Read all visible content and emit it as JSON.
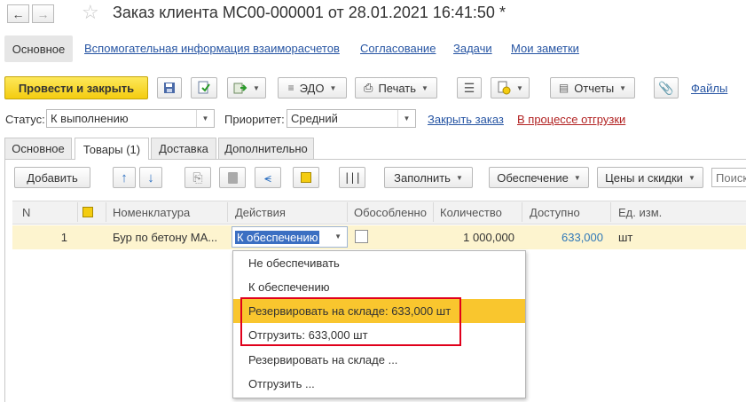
{
  "window": {
    "title": "Заказ клиента МС00-000001 от 28.01.2021 16:41:50 *",
    "back_icon": "arrow-left-icon",
    "forward_icon": "arrow-right-icon",
    "favorite_icon": "star-icon"
  },
  "topnav": {
    "items": [
      "Основное",
      "Вспомогательная информация взаиморасчетов",
      "Согласование",
      "Задачи",
      "Мои заметки"
    ]
  },
  "toolbar": {
    "post_close_label": "Провести и закрыть",
    "edo_label": "ЭДО",
    "print_label": "Печать",
    "reports_label": "Отчеты",
    "files_label": "Файлы"
  },
  "status_row": {
    "status_label": "Статус:",
    "status_value": "К выполнению",
    "priority_label": "Приоритет:",
    "priority_value": "Средний",
    "close_order_link": "Закрыть заказ",
    "shipping_link": "В процессе отгрузки"
  },
  "tabs": [
    "Основное",
    "Товары (1)",
    "Доставка",
    "Дополнительно"
  ],
  "goods_toolbar": {
    "add_label": "Добавить",
    "fill_label": "Заполнить",
    "provision_label": "Обеспечение",
    "prices_label": "Цены и скидки",
    "search_placeholder": "Поиск"
  },
  "table": {
    "columns": [
      "N",
      "",
      "Номенклатура",
      "Действия",
      "Обособленно",
      "Количество",
      "Доступно",
      "Ед. изм."
    ],
    "rows": [
      {
        "n": "1",
        "item": "Бур по бетону МА...",
        "action": "К обеспечению",
        "separate": false,
        "quantity": "1 000,000",
        "available": "633,000",
        "unit": "шт"
      }
    ]
  },
  "dropdown": {
    "items": [
      "Не обеспечивать",
      "К обеспечению",
      "Резервировать на складе: 633,000 шт",
      "Отгрузить: 633,000 шт",
      "Резервировать на складе ...",
      "Отгрузить ..."
    ],
    "highlighted_index": 2
  },
  "colors": {
    "primary_button": "#f4cc10",
    "link": "#2755a3",
    "status_link_red": "#b22222",
    "row_highlight": "#fdf4cf",
    "menu_highlight": "#f9c62e",
    "callout_border": "#e0001b",
    "available_value": "#2f78b8"
  }
}
